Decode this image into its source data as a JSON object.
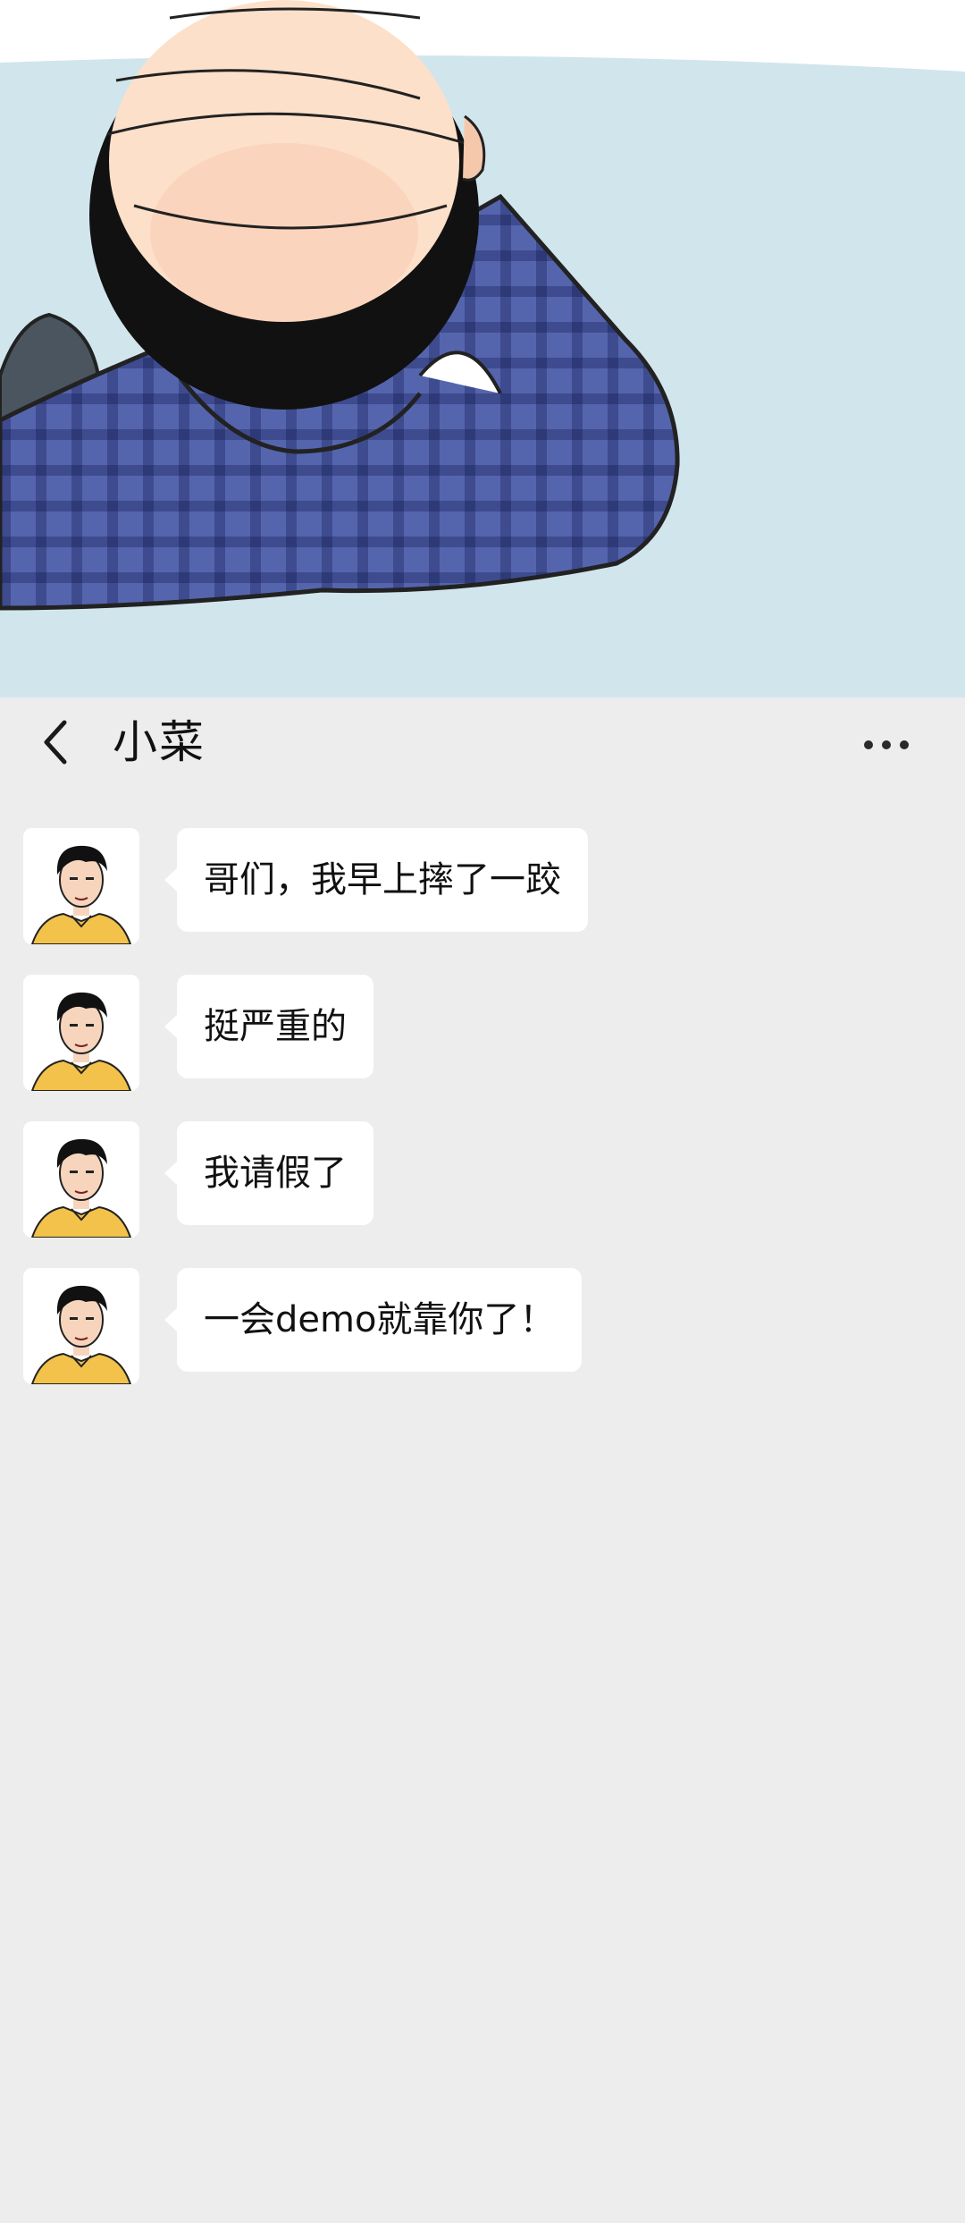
{
  "header": {
    "title": "小菜",
    "back_icon": "chevron-left-icon",
    "more_icon": "more-dots-icon"
  },
  "messages": [
    {
      "text": "哥们，我早上摔了一跤"
    },
    {
      "text": "挺严重的"
    },
    {
      "text": "我请假了"
    },
    {
      "text": "一会demo就靠你了！"
    }
  ],
  "colors": {
    "background": "#ededed",
    "bubble": "#ffffff",
    "text": "#111111",
    "comic_sky": "#d1e5ec",
    "shirt_blue": "#4a5aa5",
    "avatar_shirt": "#f2c24a"
  }
}
